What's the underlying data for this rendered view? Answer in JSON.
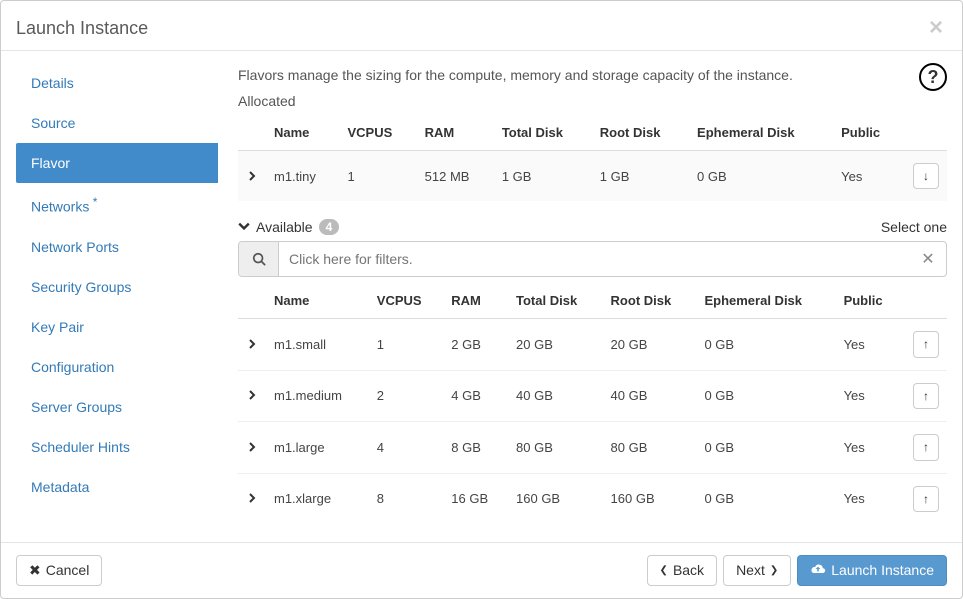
{
  "header": {
    "title": "Launch Instance"
  },
  "sidebar": {
    "items": [
      {
        "label": "Details",
        "active": false,
        "star": false
      },
      {
        "label": "Source",
        "active": false,
        "star": false
      },
      {
        "label": "Flavor",
        "active": true,
        "star": false
      },
      {
        "label": "Networks",
        "active": false,
        "star": true
      },
      {
        "label": "Network Ports",
        "active": false,
        "star": false
      },
      {
        "label": "Security Groups",
        "active": false,
        "star": false
      },
      {
        "label": "Key Pair",
        "active": false,
        "star": false
      },
      {
        "label": "Configuration",
        "active": false,
        "star": false
      },
      {
        "label": "Server Groups",
        "active": false,
        "star": false
      },
      {
        "label": "Scheduler Hints",
        "active": false,
        "star": false
      },
      {
        "label": "Metadata",
        "active": false,
        "star": false
      }
    ]
  },
  "content": {
    "description": "Flavors manage the sizing for the compute, memory and storage capacity of the instance.",
    "allocated_label": "Allocated",
    "available_label": "Available",
    "available_count": "4",
    "select_hint": "Select one",
    "filter_placeholder": "Click here for filters.",
    "columns": {
      "name": "Name",
      "vcpus": "VCPUS",
      "ram": "RAM",
      "total_disk": "Total Disk",
      "root_disk": "Root Disk",
      "ephemeral_disk": "Ephemeral Disk",
      "public": "Public"
    },
    "allocated": [
      {
        "name": "m1.tiny",
        "vcpus": "1",
        "ram": "512 MB",
        "total_disk": "1 GB",
        "root_disk": "1 GB",
        "ephemeral_disk": "0 GB",
        "public": "Yes"
      }
    ],
    "available": [
      {
        "name": "m1.small",
        "vcpus": "1",
        "ram": "2 GB",
        "total_disk": "20 GB",
        "root_disk": "20 GB",
        "ephemeral_disk": "0 GB",
        "public": "Yes"
      },
      {
        "name": "m1.medium",
        "vcpus": "2",
        "ram": "4 GB",
        "total_disk": "40 GB",
        "root_disk": "40 GB",
        "ephemeral_disk": "0 GB",
        "public": "Yes"
      },
      {
        "name": "m1.large",
        "vcpus": "4",
        "ram": "8 GB",
        "total_disk": "80 GB",
        "root_disk": "80 GB",
        "ephemeral_disk": "0 GB",
        "public": "Yes"
      },
      {
        "name": "m1.xlarge",
        "vcpus": "8",
        "ram": "16 GB",
        "total_disk": "160 GB",
        "root_disk": "160 GB",
        "ephemeral_disk": "0 GB",
        "public": "Yes"
      }
    ]
  },
  "footer": {
    "cancel": "Cancel",
    "back": "Back",
    "next": "Next",
    "launch": "Launch Instance"
  }
}
